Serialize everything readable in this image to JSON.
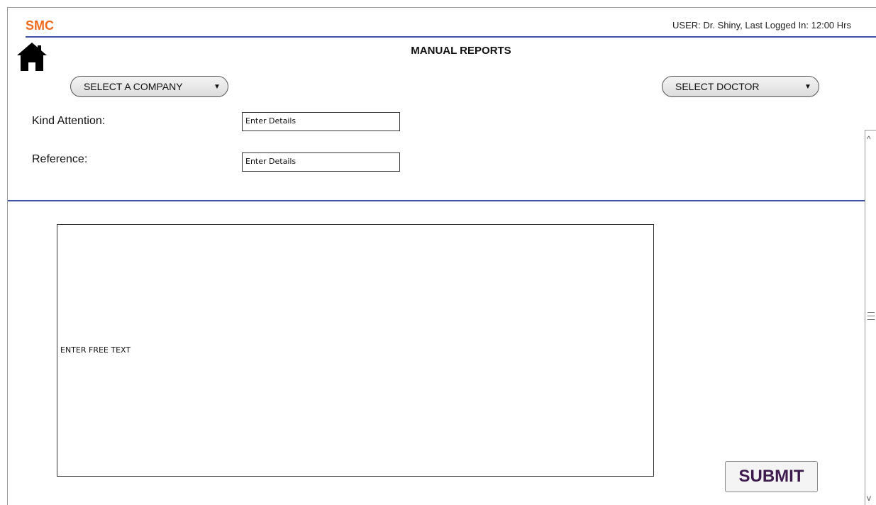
{
  "header": {
    "brand": "SMC",
    "brand_color": "#f06a1e",
    "user_info": "USER: Dr. Shiny, Last Logged In: 12:00 Hrs",
    "title": "MANUAL REPORTS",
    "home_icon": "home-icon",
    "rule_color": "#3f51a3"
  },
  "filters": {
    "company": {
      "label": "SELECT A COMPANY",
      "caret": "▼"
    },
    "doctor": {
      "label": "SELECT DOCTOR",
      "caret": "▼"
    }
  },
  "form": {
    "kind_attention": {
      "label": "Kind Attention:",
      "placeholder": "Enter Details"
    },
    "reference": {
      "label": "Reference:",
      "placeholder": "Enter Details"
    }
  },
  "free_text": {
    "placeholder": "ENTER FREE TEXT"
  },
  "actions": {
    "submit_label": "SUBMIT",
    "submit_color": "#3e1a4e"
  },
  "scrollbar": {
    "up": "^",
    "down": "v"
  }
}
